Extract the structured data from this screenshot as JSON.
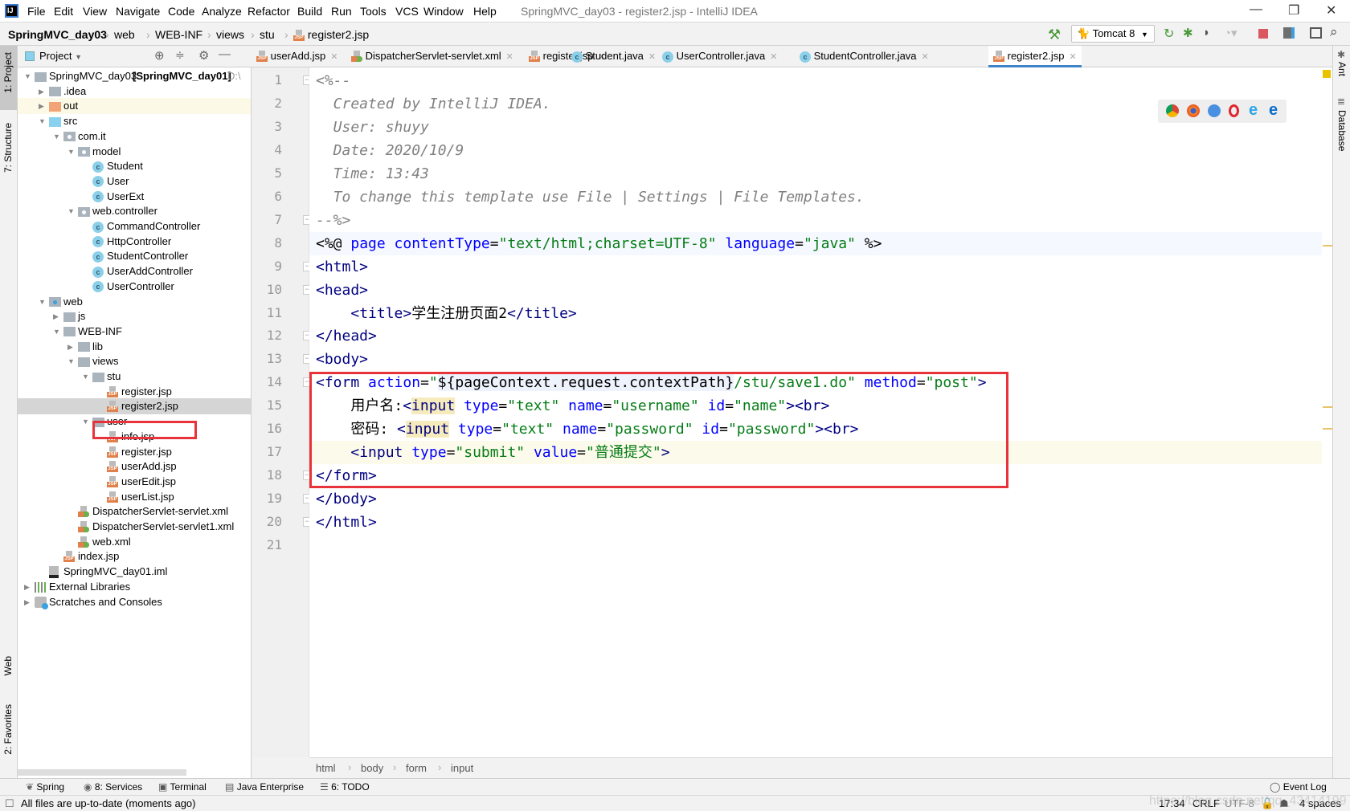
{
  "window": {
    "logo": "IJ",
    "title": "SpringMVC_day03 - register2.jsp - IntelliJ IDEA",
    "menu": [
      "File",
      "Edit",
      "View",
      "Navigate",
      "Code",
      "Analyze",
      "Refactor",
      "Build",
      "Run",
      "Tools",
      "VCS",
      "Window",
      "Help"
    ],
    "controls": {
      "minimize": "—",
      "restore": "❐",
      "close": "✕"
    }
  },
  "navbar": {
    "breadcrumb": [
      "SpringMVC_day03",
      "web",
      "WEB-INF",
      "views",
      "stu",
      "register2.jsp"
    ],
    "run_config": "Tomcat 8",
    "icons": [
      "build-hammer-icon",
      "rerun-icon",
      "debug-icon",
      "coverage-icon",
      "profile-icon",
      "stop-icon",
      "project-structure-icon",
      "run-anything-icon",
      "search-icon"
    ]
  },
  "left_strip": [
    "1: Project",
    "7: Structure",
    "Web",
    "2: Favorites"
  ],
  "right_strip": [
    "Ant",
    "Database"
  ],
  "project_panel": {
    "title": "Project",
    "tree": [
      {
        "depth": 0,
        "arrow": "open",
        "icon": "module",
        "label": "SpringMVC_day03",
        "suffix": "[SpringMVC_day01]",
        "extra": "D:\\"
      },
      {
        "depth": 1,
        "arrow": "closed",
        "icon": "folder",
        "label": ".idea"
      },
      {
        "depth": 1,
        "arrow": "closed",
        "icon": "folder-orange",
        "label": "out",
        "highlight": true
      },
      {
        "depth": 1,
        "arrow": "open",
        "icon": "folder-blue",
        "label": "src"
      },
      {
        "depth": 2,
        "arrow": "open",
        "icon": "package",
        "label": "com.it"
      },
      {
        "depth": 3,
        "arrow": "open",
        "icon": "package",
        "label": "model"
      },
      {
        "depth": 4,
        "icon": "class",
        "label": "Student"
      },
      {
        "depth": 4,
        "icon": "class",
        "label": "User"
      },
      {
        "depth": 4,
        "icon": "class",
        "label": "UserExt"
      },
      {
        "depth": 3,
        "arrow": "open",
        "icon": "package",
        "label": "web.controller"
      },
      {
        "depth": 4,
        "icon": "class",
        "label": "CommandController"
      },
      {
        "depth": 4,
        "icon": "class",
        "label": "HttpController"
      },
      {
        "depth": 4,
        "icon": "class",
        "label": "StudentController"
      },
      {
        "depth": 4,
        "icon": "class",
        "label": "UserAddController"
      },
      {
        "depth": 4,
        "icon": "class",
        "label": "UserController"
      },
      {
        "depth": 1,
        "arrow": "open",
        "icon": "folder-web",
        "label": "web"
      },
      {
        "depth": 2,
        "arrow": "closed",
        "icon": "folder",
        "label": "js"
      },
      {
        "depth": 2,
        "arrow": "open",
        "icon": "folder",
        "label": "WEB-INF"
      },
      {
        "depth": 3,
        "arrow": "closed",
        "icon": "folder",
        "label": "lib"
      },
      {
        "depth": 3,
        "arrow": "open",
        "icon": "folder",
        "label": "views"
      },
      {
        "depth": 4,
        "arrow": "open",
        "icon": "folder",
        "label": "stu"
      },
      {
        "depth": 5,
        "icon": "jsp",
        "label": "register.jsp"
      },
      {
        "depth": 5,
        "icon": "jsp",
        "label": "register2.jsp",
        "selected": true
      },
      {
        "depth": 4,
        "arrow": "open",
        "icon": "folder",
        "label": "user"
      },
      {
        "depth": 5,
        "icon": "jsp",
        "label": "info.jsp"
      },
      {
        "depth": 5,
        "icon": "jsp",
        "label": "register.jsp"
      },
      {
        "depth": 5,
        "icon": "jsp",
        "label": "userAdd.jsp"
      },
      {
        "depth": 5,
        "icon": "jsp",
        "label": "userEdit.jsp"
      },
      {
        "depth": 5,
        "icon": "jsp",
        "label": "userList.jsp"
      },
      {
        "depth": 3,
        "icon": "xml",
        "label": "DispatcherServlet-servlet.xml"
      },
      {
        "depth": 3,
        "icon": "xml",
        "label": "DispatcherServlet-servlet1.xml"
      },
      {
        "depth": 3,
        "icon": "xml",
        "label": "web.xml"
      },
      {
        "depth": 2,
        "icon": "jsp",
        "label": "index.jsp"
      },
      {
        "depth": 1,
        "icon": "iml",
        "label": "SpringMVC_day01.iml"
      },
      {
        "depth": 0,
        "arrow": "closed",
        "icon": "libraries",
        "label": "External Libraries"
      },
      {
        "depth": 0,
        "arrow": "closed",
        "icon": "scratch",
        "label": "Scratches and Consoles"
      }
    ]
  },
  "tabs": [
    {
      "label": "userAdd.jsp",
      "icon": "jsp"
    },
    {
      "label": "DispatcherServlet-servlet.xml",
      "icon": "xml"
    },
    {
      "label": "register.jsp",
      "icon": "jsp"
    },
    {
      "label": "Student.java",
      "icon": "class"
    },
    {
      "label": "UserController.java",
      "icon": "class"
    },
    {
      "label": "StudentController.java",
      "icon": "class"
    },
    {
      "label": "register2.jsp",
      "icon": "jsp",
      "active": true
    }
  ],
  "editor": {
    "current_line": 17,
    "lines": [
      [
        [
          "c",
          "<%--"
        ]
      ],
      [
        [
          "c",
          "  Created by IntelliJ IDEA."
        ]
      ],
      [
        [
          "c",
          "  User: shuyy"
        ]
      ],
      [
        [
          "c",
          "  Date: 2020/10/9"
        ]
      ],
      [
        [
          "c",
          "  Time: 13:43"
        ]
      ],
      [
        [
          "c",
          "  To change this template use File | Settings | File Templates."
        ]
      ],
      [
        [
          "c",
          "--%>"
        ]
      ],
      [
        [
          "txt",
          "<%@ "
        ],
        [
          "attr",
          "page "
        ],
        [
          "attr",
          "contentType"
        ],
        [
          "txt",
          "="
        ],
        [
          "val",
          "\"text/html;charset=UTF-8\""
        ],
        [
          "txt",
          " "
        ],
        [
          "attr",
          "language"
        ],
        [
          "txt",
          "="
        ],
        [
          "val",
          "\"java\""
        ],
        [
          "txt",
          " %>"
        ]
      ],
      [
        [
          "tag",
          "<html>"
        ]
      ],
      [
        [
          "tag",
          "<head>"
        ]
      ],
      [
        [
          "txt",
          "    "
        ],
        [
          "tag",
          "<title>"
        ],
        [
          "txt",
          "学生注册页面2"
        ],
        [
          "tag",
          "</title>"
        ]
      ],
      [
        [
          "tag",
          "</head>"
        ]
      ],
      [
        [
          "tag",
          "<body>"
        ]
      ],
      [
        [
          "tag",
          "<form "
        ],
        [
          "attr",
          "action"
        ],
        [
          "txt",
          "="
        ],
        [
          "val",
          "\""
        ],
        [
          "el",
          "${pageContext.request.contextPath}"
        ],
        [
          "val",
          "/stu/save1.do\""
        ],
        [
          "txt",
          " "
        ],
        [
          "attr",
          "method"
        ],
        [
          "txt",
          "="
        ],
        [
          "val",
          "\"post\""
        ],
        [
          "tag",
          ">"
        ]
      ],
      [
        [
          "txt",
          "    用户名:"
        ],
        [
          "tag",
          "<"
        ],
        [
          "hl",
          "input"
        ],
        [
          "txt",
          " "
        ],
        [
          "attr",
          "type"
        ],
        [
          "txt",
          "="
        ],
        [
          "val",
          "\"text\""
        ],
        [
          "txt",
          " "
        ],
        [
          "attr",
          "name"
        ],
        [
          "txt",
          "="
        ],
        [
          "val",
          "\"username\""
        ],
        [
          "txt",
          " "
        ],
        [
          "attr",
          "id"
        ],
        [
          "txt",
          "="
        ],
        [
          "val",
          "\"name\""
        ],
        [
          "tag",
          "><br>"
        ]
      ],
      [
        [
          "txt",
          "    密码: "
        ],
        [
          "tag",
          "<"
        ],
        [
          "hl",
          "input"
        ],
        [
          "txt",
          " "
        ],
        [
          "attr",
          "type"
        ],
        [
          "txt",
          "="
        ],
        [
          "val",
          "\"text\""
        ],
        [
          "txt",
          " "
        ],
        [
          "attr",
          "name"
        ],
        [
          "txt",
          "="
        ],
        [
          "val",
          "\"password\""
        ],
        [
          "txt",
          " "
        ],
        [
          "attr",
          "id"
        ],
        [
          "txt",
          "="
        ],
        [
          "val",
          "\"password\""
        ],
        [
          "tag",
          "><br>"
        ]
      ],
      [
        [
          "txt",
          "    "
        ],
        [
          "tag",
          "<input "
        ],
        [
          "attr",
          "type"
        ],
        [
          "txt",
          "="
        ],
        [
          "val",
          "\"submit\""
        ],
        [
          "txt",
          " "
        ],
        [
          "attr",
          "value"
        ],
        [
          "txt",
          "="
        ],
        [
          "val",
          "\"普通提交\""
        ],
        [
          "tag",
          ">"
        ]
      ],
      [
        [
          "tag",
          "</form>"
        ]
      ],
      [
        [
          "tag",
          "</body>"
        ]
      ],
      [
        [
          "tag",
          "</html>"
        ]
      ],
      []
    ],
    "fold_lines": [
      1,
      7,
      9,
      10,
      12,
      13,
      14,
      18,
      19,
      20
    ],
    "browser_icons": [
      "chrome-icon",
      "firefox-icon",
      "safari-icon",
      "opera-icon",
      "ie-icon",
      "edge-icon"
    ],
    "breadcrumb": [
      "html",
      "body",
      "form",
      "input"
    ]
  },
  "bottom_tools": [
    "Spring",
    "8: Services",
    "Terminal",
    "Java Enterprise",
    "6: TODO",
    "Event Log"
  ],
  "status": {
    "message": "All files are up-to-date (moments ago)",
    "position": "17:34",
    "line_separator": "CRLF",
    "encoding": "UTF-8",
    "indent": "4 spaces",
    "watermark": "https://blog.csdn.net/qq_43414199"
  },
  "colors": {
    "accent": "#4083c9",
    "highlight_box": "#e8333a",
    "tag": "#000080",
    "attr": "#0000ff",
    "value": "#067d17",
    "comment": "#808080"
  }
}
